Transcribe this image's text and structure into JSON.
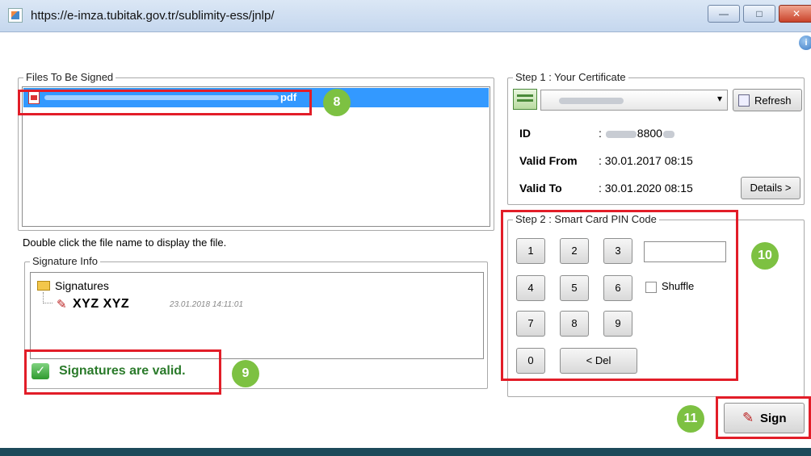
{
  "window": {
    "title": "https://e-imza.tubitak.gov.tr/sublimity-ess/jnlp/",
    "minimize_glyph": "—",
    "maximize_glyph": "□",
    "close_glyph": "✕",
    "help_glyph": "i"
  },
  "files_panel": {
    "legend": "Files To Be Signed",
    "file_name_suffix": "pdf",
    "hint": "Double click the file name to display the file."
  },
  "signature_info": {
    "legend": "Signature Info",
    "root_label": "Signatures",
    "signer_name": "XYZ XYZ",
    "signature_date": "23.01.2018 14:11:01",
    "status_icon": "✓",
    "status_text": "Signatures are valid."
  },
  "step1": {
    "legend": "Step 1 : Your Certificate",
    "refresh_label": "Refresh",
    "id_label": "ID",
    "id_value_visible": "8800",
    "valid_from_label": "Valid From",
    "valid_from_value": ": 30.01.2017 08:15",
    "valid_to_label": "Valid To",
    "valid_to_value": ": 30.01.2020 08:15",
    "details_label": "Details >"
  },
  "step2": {
    "legend": "Step 2 : Smart Card PIN Code",
    "keys": [
      "1",
      "2",
      "3",
      "4",
      "5",
      "6",
      "7",
      "8",
      "9",
      "0"
    ],
    "delete_label": "< Del",
    "shuffle_label": "Shuffle",
    "shuffle_checked": false,
    "pin_value": ""
  },
  "actions": {
    "sign_label": "Sign"
  },
  "annotations": {
    "badge_8": "8",
    "badge_9": "9",
    "badge_10": "10",
    "badge_11": "11",
    "highlight_color": "#e21d28",
    "badge_color": "#7dc142"
  },
  "icons": {
    "pen": "✎",
    "combo_arrow": "▾",
    "id_colon": ": "
  }
}
